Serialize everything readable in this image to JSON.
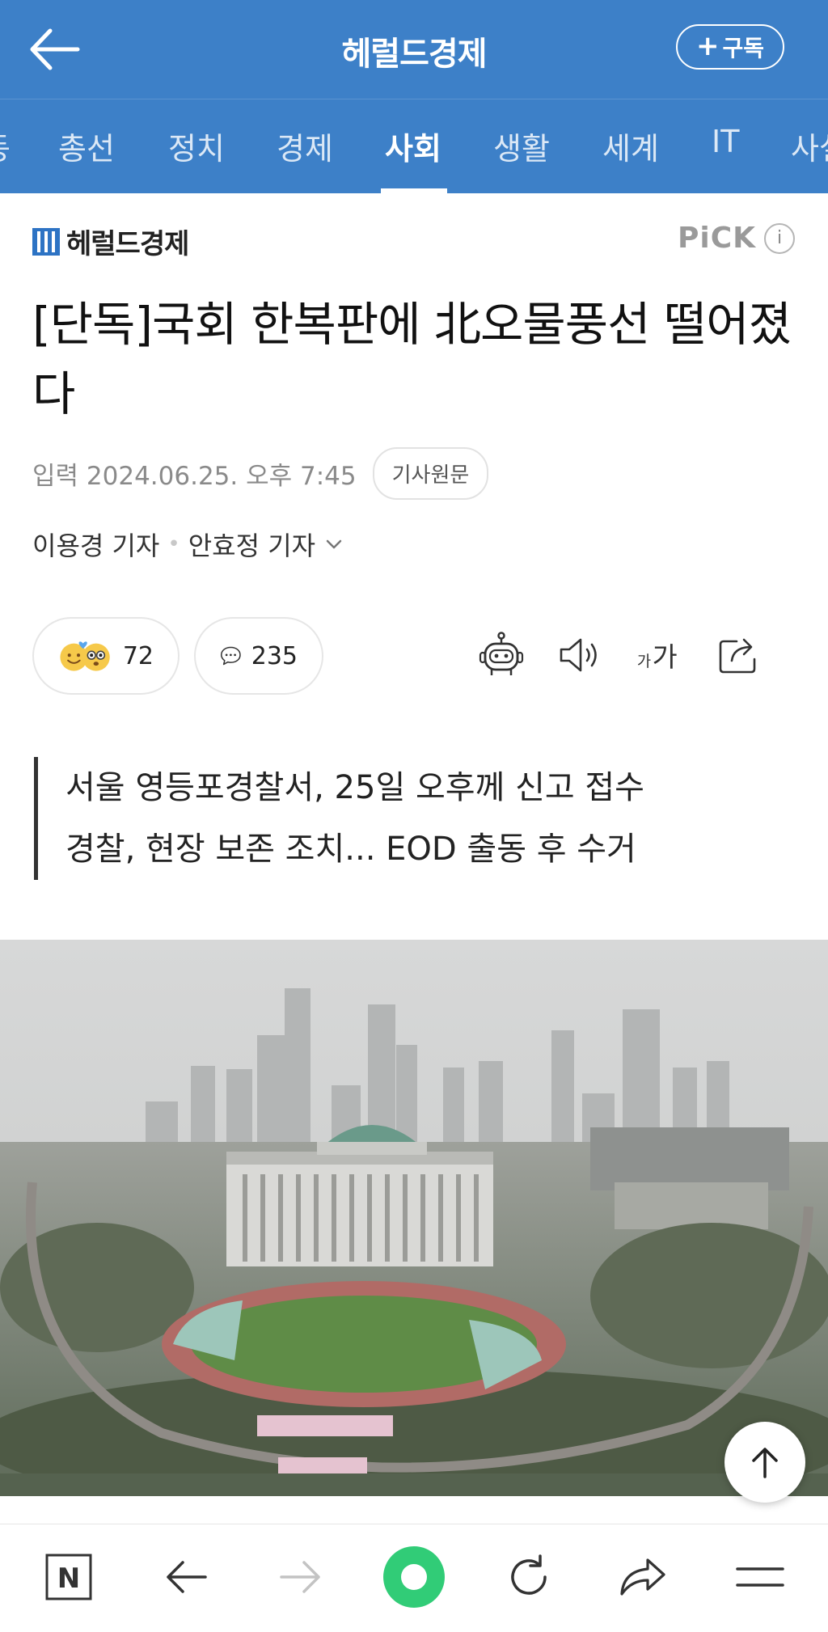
{
  "header": {
    "title": "헤럴드경제",
    "subscribe_label": "구독",
    "subscribe_plus": "+"
  },
  "categories": {
    "items": [
      {
        "label": "동"
      },
      {
        "label": "총선"
      },
      {
        "label": "정치"
      },
      {
        "label": "경제"
      },
      {
        "label": "사회"
      },
      {
        "label": "생활"
      },
      {
        "label": "세계"
      },
      {
        "label": "IT"
      },
      {
        "label": "사설"
      }
    ],
    "active": "사회"
  },
  "press": {
    "name": "헤럴드경제",
    "pick_label": "PiCK",
    "info_label": "i"
  },
  "article": {
    "headline": "[단독]국회 한복판에 北오물풍선 떨어졌다",
    "date": "입력 2024.06.25. 오후 7:45",
    "original_button": "기사원문",
    "authors": [
      "이용경 기자",
      "안효정 기자"
    ],
    "reaction_count": "72",
    "comment_count": "235",
    "summary": [
      "서울 영등포경찰서, 25일 오후께 신고 접수",
      "경찰, 현장 보존 조치... EOD 출동 후 수거"
    ]
  },
  "colors": {
    "header_bg": "#3d80c8",
    "brand_blue": "#2d73c4",
    "pick_gray": "#9a9a9a"
  },
  "icons": {
    "back": "arrow-left-icon",
    "summary_bot": "robot-icon",
    "tts": "speaker-icon",
    "font_size": "font-size-icon",
    "share": "share-icon",
    "scroll_top": "arrow-up-icon"
  },
  "bottom_nav": {
    "home_label": "N"
  }
}
